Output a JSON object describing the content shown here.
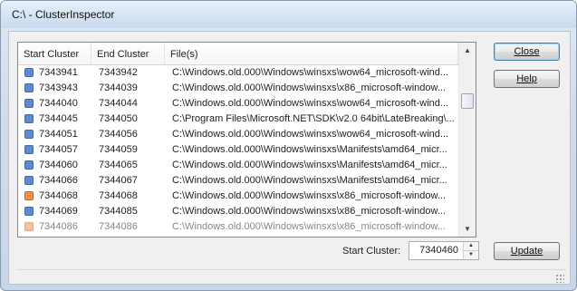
{
  "window": {
    "title": "C:\\ - ClusterInspector"
  },
  "colors": {
    "blue_chip": "#5b8bd0",
    "orange_chip": "#f0904a"
  },
  "list": {
    "headers": [
      "Start Cluster",
      "End Cluster",
      "File(s)"
    ],
    "rows": [
      {
        "start": "7343941",
        "end": "7343942",
        "file": "C:\\Windows.old.000\\Windows\\winsxs\\wow64_microsoft-wind...",
        "color": "#5b8bd0"
      },
      {
        "start": "7343943",
        "end": "7344039",
        "file": "C:\\Windows.old.000\\Windows\\winsxs\\x86_microsoft-window...",
        "color": "#5b8bd0"
      },
      {
        "start": "7344040",
        "end": "7344044",
        "file": "C:\\Windows.old.000\\Windows\\winsxs\\wow64_microsoft-wind...",
        "color": "#5b8bd0"
      },
      {
        "start": "7344045",
        "end": "7344050",
        "file": "C:\\Program Files\\Microsoft.NET\\SDK\\v2.0 64bit\\LateBreaking\\...",
        "color": "#5b8bd0"
      },
      {
        "start": "7344051",
        "end": "7344056",
        "file": "C:\\Windows.old.000\\Windows\\winsxs\\wow64_microsoft-wind...",
        "color": "#5b8bd0"
      },
      {
        "start": "7344057",
        "end": "7344059",
        "file": "C:\\Windows.old.000\\Windows\\winsxs\\Manifests\\amd64_micr...",
        "color": "#5b8bd0"
      },
      {
        "start": "7344060",
        "end": "7344065",
        "file": "C:\\Windows.old.000\\Windows\\winsxs\\Manifests\\amd64_micr...",
        "color": "#5b8bd0"
      },
      {
        "start": "7344066",
        "end": "7344067",
        "file": "C:\\Windows.old.000\\Windows\\winsxs\\Manifests\\amd64_micr...",
        "color": "#5b8bd0"
      },
      {
        "start": "7344068",
        "end": "7344068",
        "file": "C:\\Windows.old.000\\Windows\\winsxs\\x86_microsoft-window...",
        "color": "#f0904a"
      },
      {
        "start": "7344069",
        "end": "7344085",
        "file": "C:\\Windows.old.000\\Windows\\winsxs\\x86_microsoft-window...",
        "color": "#5b8bd0"
      },
      {
        "start": "7344086",
        "end": "7344086",
        "file": "C:\\Windows.old.000\\Windows\\winsxs\\x86_microsoft-window...",
        "color": "#f0904a"
      }
    ]
  },
  "buttons": {
    "close": "Close",
    "help": "Help",
    "update": "Update"
  },
  "start_cluster": {
    "label": "Start Cluster:",
    "value": "7340460"
  }
}
